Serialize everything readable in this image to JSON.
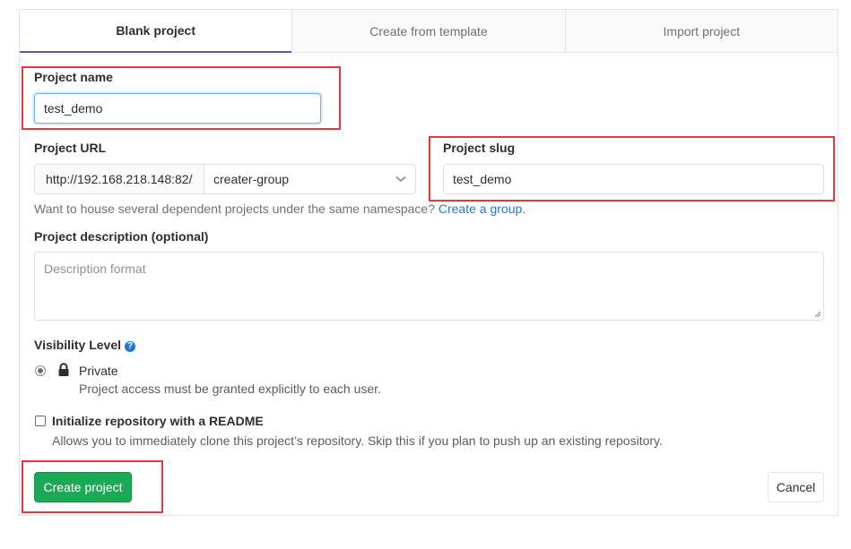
{
  "tabs": [
    {
      "label": "Blank project",
      "active": true
    },
    {
      "label": "Create from template",
      "active": false
    },
    {
      "label": "Import project",
      "active": false
    }
  ],
  "form": {
    "project_name_label": "Project name",
    "project_name_value": "test_demo",
    "project_url_label": "Project URL",
    "url_prefix": "http://192.168.218.148:82/",
    "namespace_value": "creater-group",
    "project_slug_label": "Project slug",
    "project_slug_value": "test_demo",
    "namespace_help": "Want to house several dependent projects under the same namespace?",
    "namespace_help_link": "Create a group.",
    "description_label": "Project description (optional)",
    "description_placeholder": "Description format",
    "visibility_label": "Visibility Level",
    "visibility_help_icon": "question-circle-icon",
    "visibility_option_label": "Private",
    "visibility_option_icon": "lock-icon",
    "visibility_option_desc": "Project access must be granted explicitly to each user.",
    "readme_label": "Initialize repository with a README",
    "readme_desc": "Allows you to immediately clone this project’s repository. Skip this if you plan to push up an existing repository."
  },
  "buttons": {
    "create_label": "Create project",
    "cancel_label": "Cancel"
  },
  "colors": {
    "accent_green": "#1aaa55",
    "link_blue": "#1f78d1",
    "highlight_red": "#e7373b",
    "active_tab_underline": "#6b4fbb"
  }
}
